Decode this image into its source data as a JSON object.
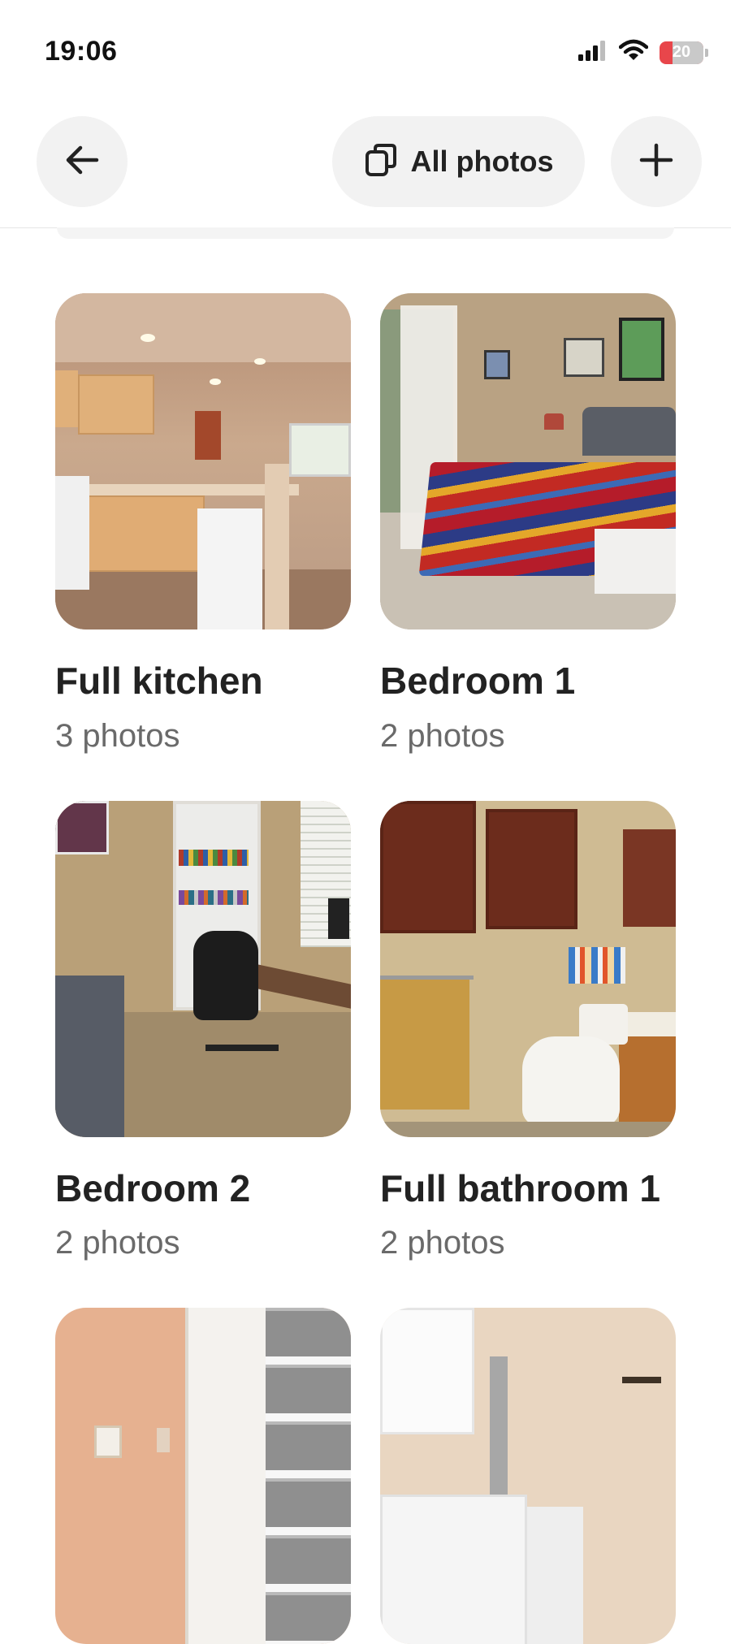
{
  "status_bar": {
    "time": "19:06",
    "battery_level": "20",
    "icons": [
      "signal-icon",
      "wifi-icon",
      "battery-icon"
    ]
  },
  "header": {
    "back_icon": "arrow-left-icon",
    "all_photos_label": "All photos",
    "all_photos_icon": "stacked-photos-icon",
    "add_icon": "plus-icon"
  },
  "rooms": [
    {
      "title": "Full kitchen",
      "count": "3 photos"
    },
    {
      "title": "Bedroom 1",
      "count": "2 photos"
    },
    {
      "title": "Bedroom 2",
      "count": "2 photos"
    },
    {
      "title": "Full bathroom 1",
      "count": "2 photos"
    },
    {
      "title": "",
      "count": ""
    },
    {
      "title": "",
      "count": ""
    }
  ],
  "colors": {
    "button_bg": "#f2f2f2",
    "text_primary": "#222222",
    "text_secondary": "#6a6a6a",
    "battery_low": "#e8464b"
  }
}
